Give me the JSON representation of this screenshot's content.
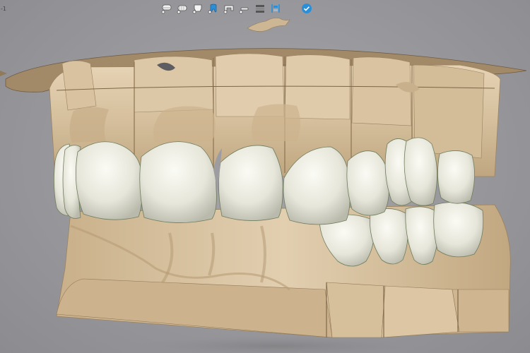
{
  "corner_label": "-1",
  "toolbar": {
    "tools": [
      {
        "icon": "upper-jaw-visibility-icon"
      },
      {
        "icon": "lower-jaw-visibility-icon"
      },
      {
        "icon": "gingiva-visibility-icon"
      },
      {
        "icon": "tooth-visibility-icon"
      },
      {
        "icon": "bridge-visibility-icon"
      },
      {
        "icon": "implant-visibility-icon"
      },
      {
        "icon": "layers-icon"
      },
      {
        "icon": "articulator-icon"
      },
      {
        "icon": "confirm-check-icon"
      }
    ]
  },
  "colors": {
    "background": "#9a9a9e",
    "stone_model": "#d9c4a4",
    "tooth_crown": "#e8e8dc",
    "toolbar_accent": "#2a8fd6"
  }
}
